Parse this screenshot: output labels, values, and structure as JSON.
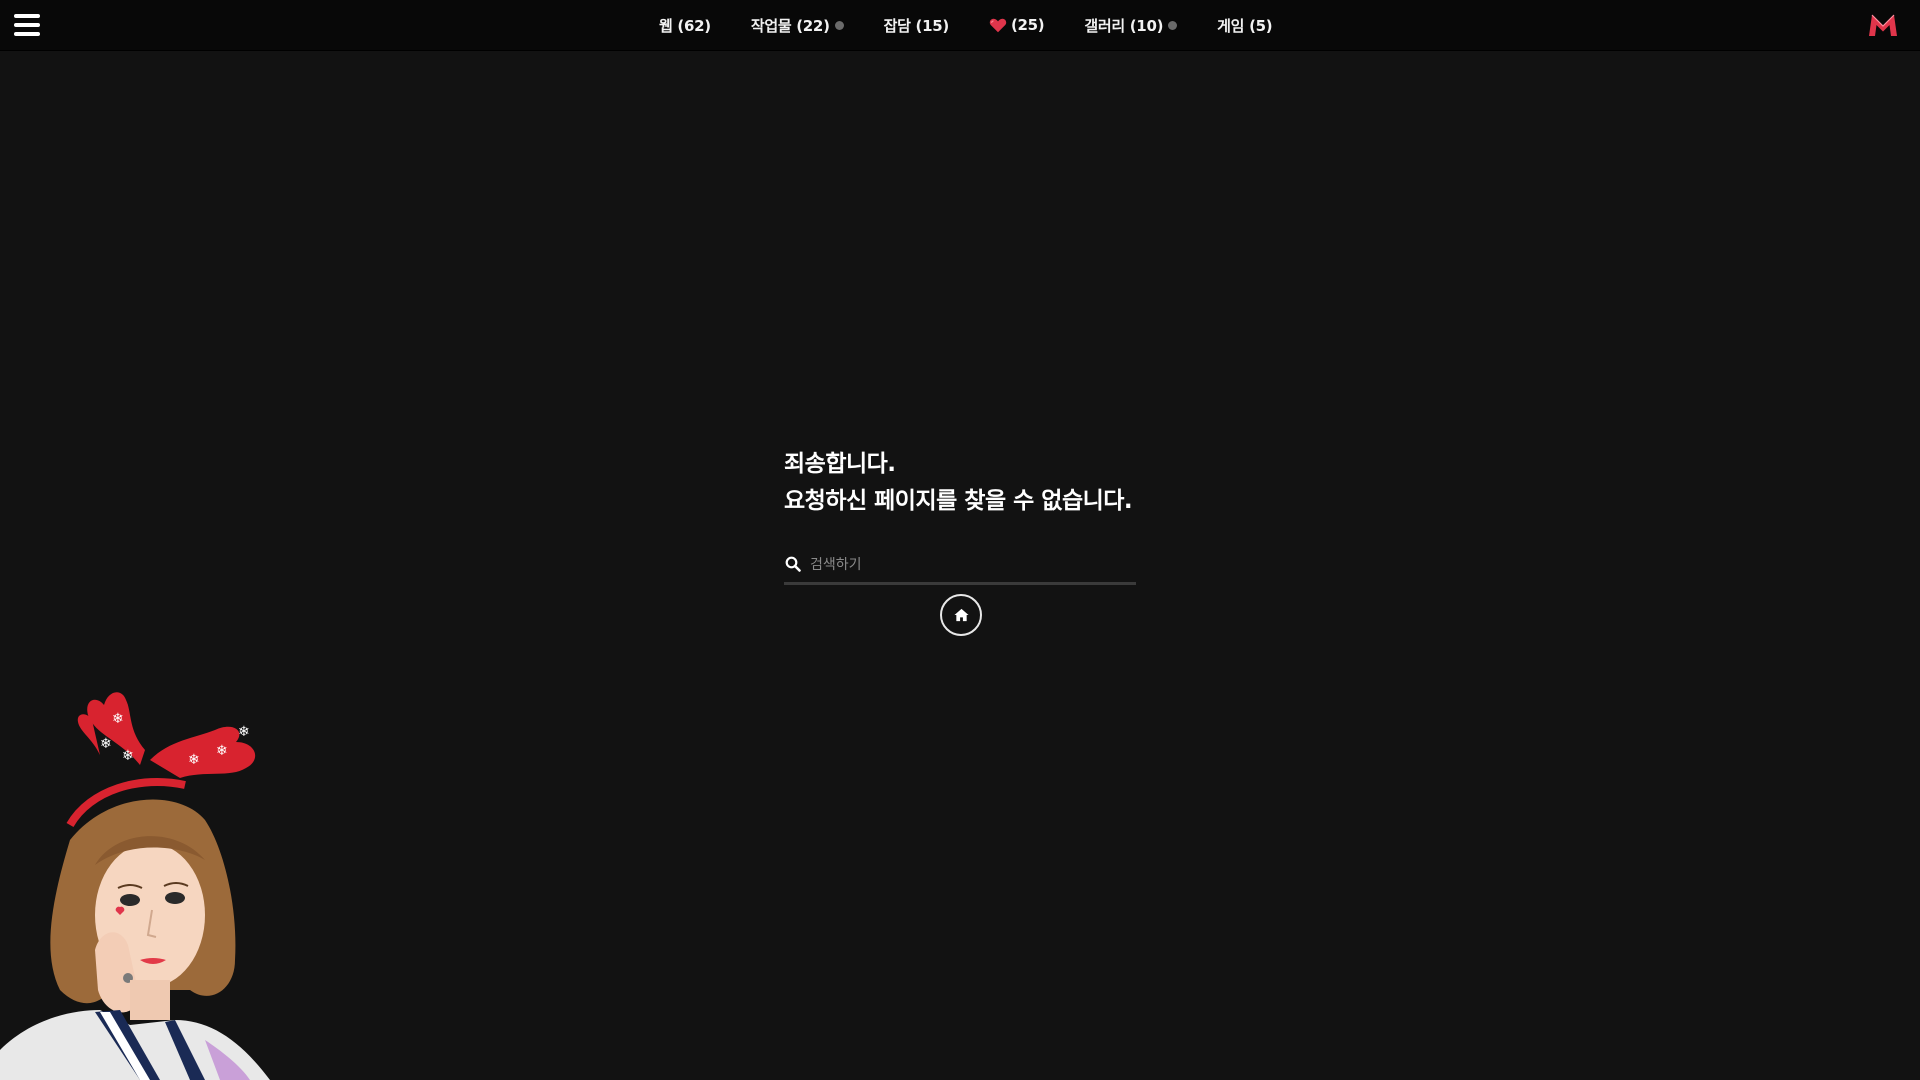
{
  "nav": {
    "items": [
      {
        "label": "웹 (62)",
        "has_dot": false,
        "icon": null
      },
      {
        "label": "작업물 (22)",
        "has_dot": true,
        "icon": null
      },
      {
        "label": "잡담 (15)",
        "has_dot": false,
        "icon": null
      },
      {
        "label": "(25)",
        "has_dot": false,
        "icon": "heart-icon"
      },
      {
        "label": "갤러리 (10)",
        "has_dot": true,
        "icon": null
      },
      {
        "label": "게임 (5)",
        "has_dot": false,
        "icon": null
      }
    ],
    "menu_icon": "hamburger-menu-icon",
    "logo_icon": "m-logo-icon"
  },
  "error": {
    "line1": "죄송합니다.",
    "line2": "요청하신 페이지를 찾을 수 없습니다."
  },
  "search": {
    "placeholder": "검색하기",
    "value": ""
  },
  "home": {
    "icon": "home-icon"
  },
  "colors": {
    "background": "#121212",
    "topbar": "#080808",
    "accent": "#e0354b",
    "dot": "#6a6a6a"
  }
}
